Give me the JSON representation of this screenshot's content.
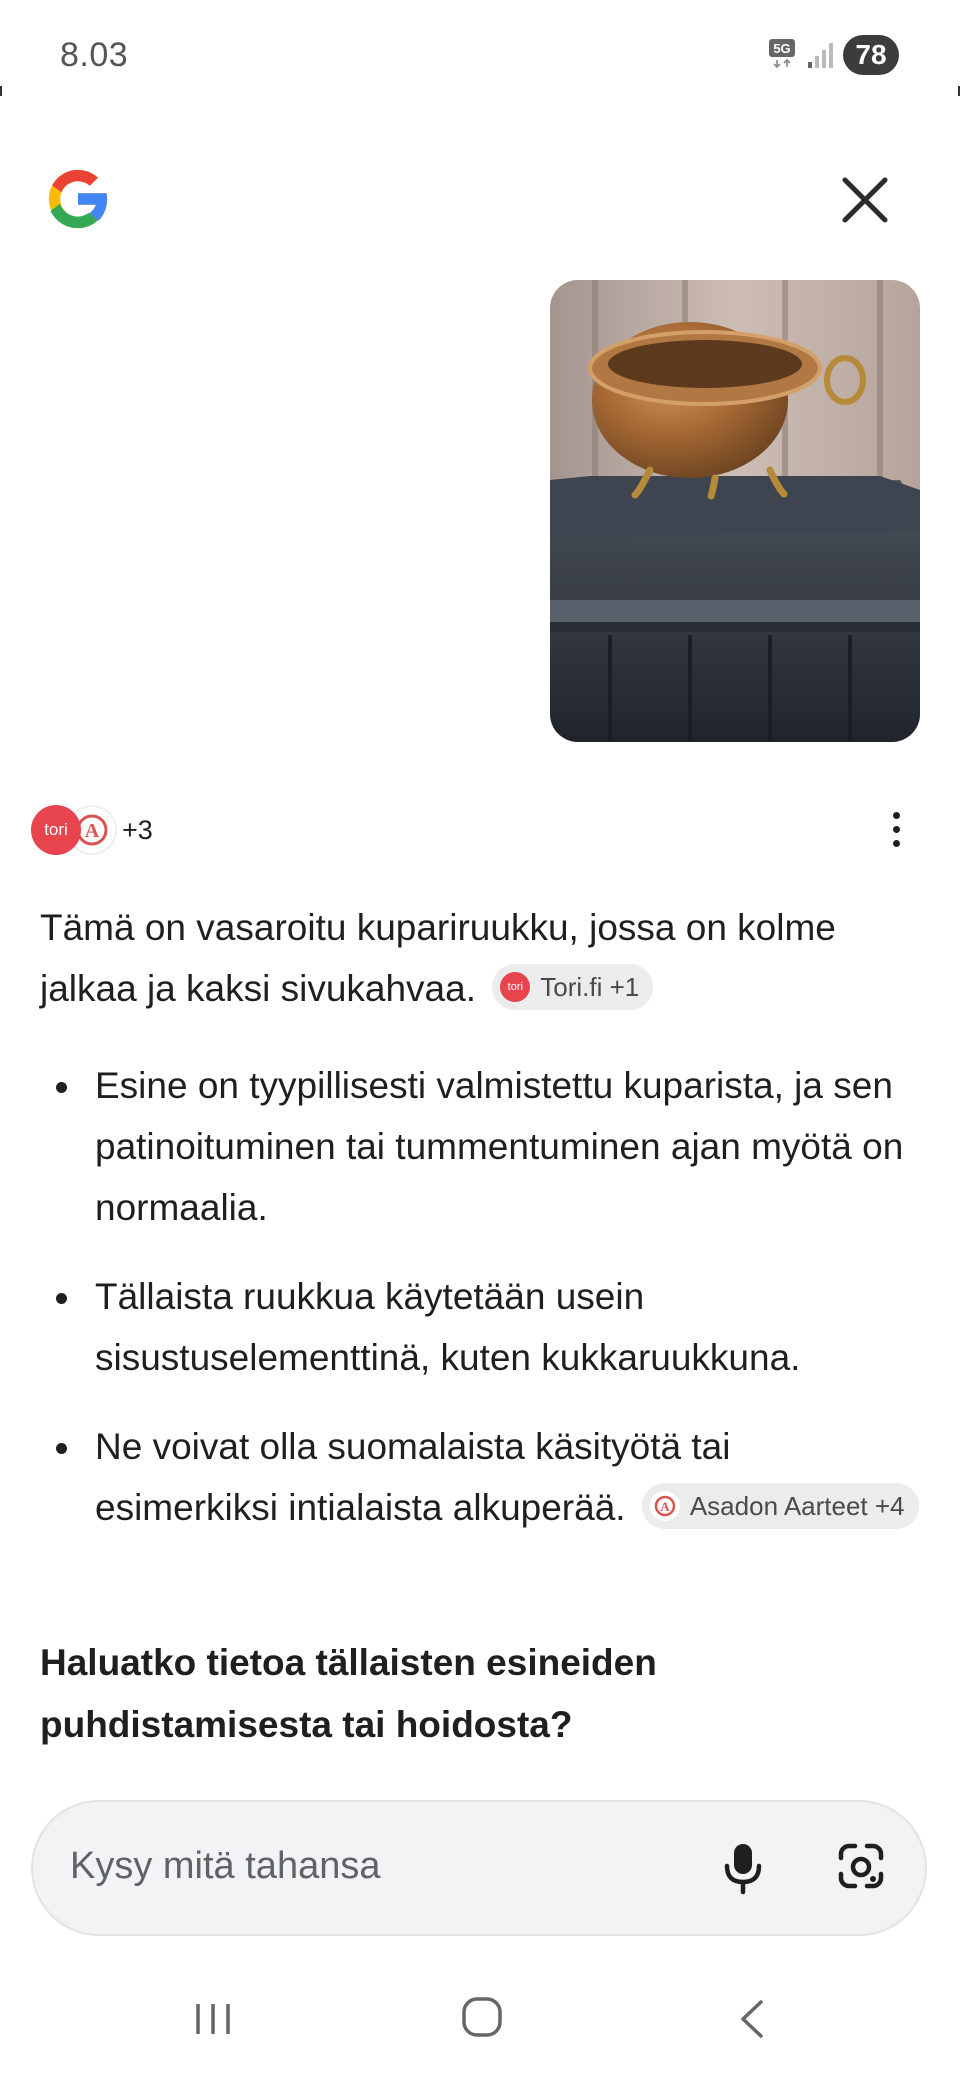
{
  "status_bar": {
    "time": "8.03",
    "network": "5G",
    "battery": "78"
  },
  "header": {
    "logo_icon": "google-g-icon",
    "close_icon": "close-icon"
  },
  "sources": {
    "count_label": "+3",
    "avatars": [
      "tori",
      "asadon-aarteet"
    ],
    "tori_avatar_text": "tori"
  },
  "answer": {
    "intro_text": "Tämä on vasaroitu kupariruukku, jossa on kolme jalkaa ja kaksi sivukahvaa.",
    "intro_chip": {
      "logo_text": "tori",
      "label": "Tori.fi +1"
    },
    "bullets": [
      {
        "text": "Esine on tyypillisesti valmistettu kuparista, ja sen patinoituminen tai tummentuminen ajan myötä on normaalia."
      },
      {
        "text": "Tällaista ruukkua käytetään usein sisustuselementtinä, kuten kukkaruukkuna."
      },
      {
        "text": "Ne voivat olla suomalaista käsityötä tai esimerkiksi intialaista alkuperää.",
        "chip_label": "Asadon Aarteet +4"
      }
    ],
    "followup_question": "Haluatko tietoa tällaisten esineiden puhdistamisesta tai hoidosta?"
  },
  "ask_bar": {
    "placeholder": "Kysy mitä tahansa",
    "mic_icon": "microphone-icon",
    "lens_icon": "google-lens-icon"
  },
  "nav_bar": {
    "icons": [
      "recent-apps-icon",
      "home-icon",
      "back-icon"
    ]
  },
  "colors": {
    "tori_red": "#e8444d",
    "google_blue": "#4285f4",
    "google_red": "#ea4335",
    "google_yellow": "#fbbc05",
    "google_green": "#34a853",
    "chip_bg": "#ececec",
    "ask_bar_bg": "#f1f3f4"
  }
}
